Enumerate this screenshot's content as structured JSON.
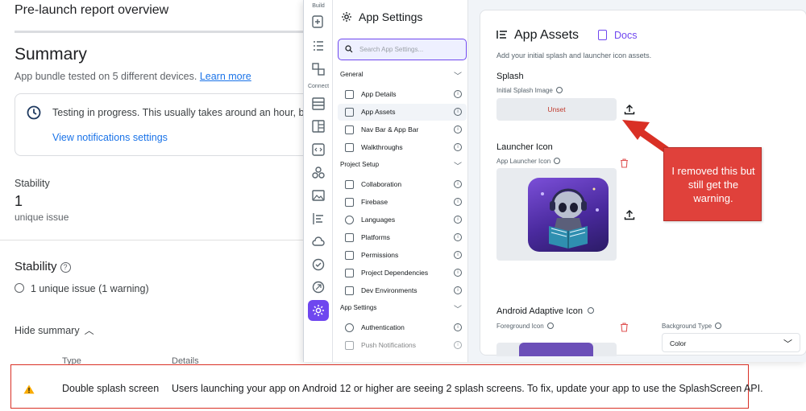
{
  "report": {
    "title": "Pre-launch report overview",
    "summary_heading": "Summary",
    "summary_sub": "App bundle tested on 5 different devices.",
    "learn_more": "Learn more",
    "info_message": "Testing in progress. This usually takes around an hour, but c",
    "info_link": "View notifications settings",
    "stability_label": "Stability",
    "stability_value": "1",
    "stability_sub": "unique issue",
    "stability_heading": "Stability",
    "stability_issue": "1 unique issue (1 warning)",
    "hide_summary": "Hide summary",
    "col_type": "Type",
    "col_details": "Details"
  },
  "issue": {
    "type": "Double splash screen",
    "details": "Users launching your app on Android 12 or higher are seeing 2 splash screens. To fix, update your app to use the SplashScreen API.",
    "warning_color": "#f9ab00"
  },
  "rail": {
    "build_label": "Build",
    "connect_label": "Connect",
    "icons": [
      "add-page-icon",
      "list-icon",
      "widget-tree-icon",
      "storyboard-icon",
      "page-layout-icon",
      "code-icon",
      "integrations-icon",
      "media-icon",
      "theme-icon",
      "cloud-icon",
      "check-icon",
      "agent-icon",
      "settings-icon"
    ],
    "accent": "#6f47ef"
  },
  "settings": {
    "title": "App Settings",
    "search_placeholder": "Search App Settings...",
    "sections": [
      {
        "label": "General",
        "items": [
          {
            "label": "App Details",
            "icon": "gear-icon"
          },
          {
            "label": "App Assets",
            "icon": "assets-icon",
            "active": true
          },
          {
            "label": "Nav Bar & App Bar",
            "icon": "navbar-icon"
          },
          {
            "label": "Walkthroughs",
            "icon": "walkthrough-icon"
          }
        ]
      },
      {
        "label": "Project Setup",
        "items": [
          {
            "label": "Collaboration",
            "icon": "people-icon"
          },
          {
            "label": "Firebase",
            "icon": "firebase-icon"
          },
          {
            "label": "Languages",
            "icon": "globe-icon"
          },
          {
            "label": "Platforms",
            "icon": "devices-icon"
          },
          {
            "label": "Permissions",
            "icon": "key-icon"
          },
          {
            "label": "Project Dependencies",
            "icon": "dependencies-icon"
          },
          {
            "label": "Dev Environments",
            "icon": "wrench-icon"
          }
        ]
      },
      {
        "label": "App Settings",
        "items": [
          {
            "label": "Authentication",
            "icon": "person-icon"
          },
          {
            "label": "Push Notifications",
            "icon": "bell-icon",
            "dim": true
          }
        ]
      }
    ]
  },
  "assets": {
    "title": "App Assets",
    "docs": "Docs",
    "description": "Add your initial splash and launcher icon assets.",
    "splash_heading": "Splash",
    "splash_sub": "Initial Splash Image",
    "unset_label": "Unset",
    "launcher_heading": "Launcher Icon",
    "launcher_sub": "App Launcher Icon",
    "adaptive_heading": "Android Adaptive Icon",
    "foreground_sub": "Foreground Icon",
    "bg_type_label": "Background Type",
    "bg_type_value": "Color"
  },
  "annotation": {
    "text": "I removed this but still get the warning.",
    "color": "#e0413b"
  }
}
